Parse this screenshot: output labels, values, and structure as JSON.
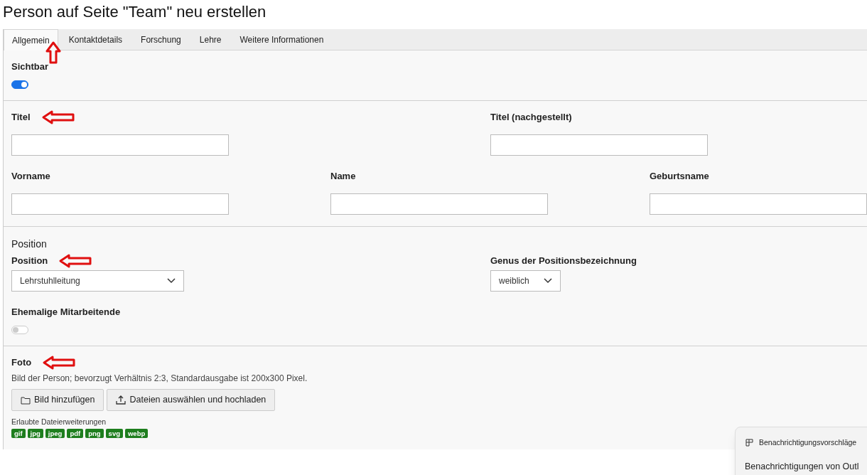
{
  "page_title": "Person auf Seite \"Team\" neu erstellen",
  "tabs": [
    {
      "label": "Allgemein",
      "selected": true,
      "arrow": true
    },
    {
      "label": "Kontaktdetails",
      "selected": false,
      "arrow": false
    },
    {
      "label": "Forschung",
      "selected": false,
      "arrow": false
    },
    {
      "label": "Lehre",
      "selected": false,
      "arrow": false
    },
    {
      "label": "Weitere Informationen",
      "selected": false,
      "arrow": false
    }
  ],
  "sections": [
    {
      "rows": [
        {
          "fields": [
            {
              "kind": "toggle",
              "label": "Sichtbar",
              "on": true,
              "arrow": false
            }
          ]
        }
      ]
    },
    {
      "rows": [
        {
          "fields": [
            {
              "kind": "text",
              "label": "Titel",
              "arrow": true
            },
            {
              "kind": "text",
              "label": "Titel (nachgestellt)",
              "arrow": false
            }
          ]
        },
        {
          "fields": [
            {
              "kind": "text",
              "label": "Vorname",
              "arrow": false
            },
            {
              "kind": "text",
              "label": "Name",
              "arrow": false
            },
            {
              "kind": "text",
              "label": "Geburtsname",
              "arrow": false
            }
          ]
        }
      ]
    },
    {
      "heading": "Position",
      "rows": [
        {
          "fields": [
            {
              "kind": "select",
              "label": "Position",
              "value": "Lehrstuhlleitung",
              "arrow": true
            },
            {
              "kind": "select",
              "label": "Genus der Positionsbezeichnung",
              "value": "weiblich",
              "arrow": false
            }
          ]
        },
        {
          "fields": [
            {
              "kind": "toggle",
              "label": "Ehemalige Mitarbeitende",
              "on": false,
              "arrow": false
            }
          ]
        }
      ]
    },
    {
      "rows": [
        {
          "fields": [
            {
              "kind": "upload",
              "label": "Foto",
              "arrow": true,
              "description": "Bild der Person; bevorzugt Verhältnis 2:3, Standardausgabe ist 200x300 Pixel.",
              "buttons": [
                {
                  "kind": "folder",
                  "label": "Bild hinzufügen"
                },
                {
                  "kind": "upload",
                  "label": "Dateien auswählen und hochladen"
                }
              ],
              "extensions_label": "Erlaubte Dateierweiterungen",
              "extensions": [
                "gif",
                "jpg",
                "jpeg",
                "pdf",
                "png",
                "svg",
                "webp"
              ]
            }
          ]
        }
      ]
    }
  ],
  "notification": {
    "items": [
      {
        "kind": "icon",
        "text": "Benachrichtigungsvorschläge"
      },
      {
        "kind": "plain",
        "text": "Benachrichtigungen von Outl"
      }
    ]
  }
}
